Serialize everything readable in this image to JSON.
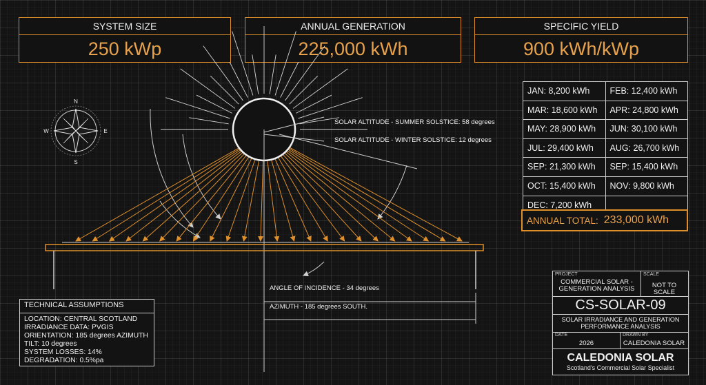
{
  "kpis": [
    {
      "label": "SYSTEM SIZE",
      "value": "250 kWp"
    },
    {
      "label": "ANNUAL GENERATION",
      "value": "225,000 kWh"
    },
    {
      "label": "SPECIFIC YIELD",
      "value": "900 kWh/kWp"
    }
  ],
  "diagram": {
    "summer_label": "SOLAR ALTITUDE - SUMMER SOLSTICE: 58 degrees",
    "winter_label": "SOLAR ALTITUDE - WINTER SOLSTICE: 12 degrees",
    "incidence_label": "ANGLE OF INCIDENCE - 34 degrees",
    "azimuth_label": "AZIMUTH - 185 degrees SOUTH.",
    "compass": {
      "n": "N",
      "e": "E",
      "s": "S",
      "w": "W"
    }
  },
  "monthly": {
    "rows": [
      [
        "JAN:  8,200 kWh",
        "FEB:  12,400 kWh"
      ],
      [
        "MAR: 18,600 kWh",
        "APR: 24,800 kWh"
      ],
      [
        "MAY: 28,900 kWh",
        "JUN: 30,100 kWh"
      ],
      [
        "JUL:  29,400 kWh",
        "AUG: 26,700 kWh"
      ],
      [
        "SEP: 21,300 kWh",
        "SEP: 15,400 kWh"
      ],
      [
        "OCT: 15,400 kWh",
        "NOV:  9,800 kWh"
      ],
      [
        "DEC:  7,200 kWh",
        ""
      ]
    ],
    "annual_label": "ANNUAL TOTAL:",
    "annual_value": "233,000 kWh"
  },
  "technical": {
    "title": "TECHNICAL ASSUMPTIONS",
    "lines": [
      "LOCATION: CENTRAL SCOTLAND",
      "IRRADIANCE DATA: PVGIS",
      "ORIENTATION: 185 degrees AZIMUTH",
      "TILT: 10 degrees",
      "SYSTEM LOSSES: 14%",
      "DEGRADATION: 0.5%pa"
    ]
  },
  "title_block": {
    "project_caption": "PROJECT",
    "project_line1": "COMMERCIAL SOLAR -",
    "project_line2": "GENERATION ANALYSIS",
    "scale_caption": "SCALE",
    "scale_value": "NOT TO SCALE",
    "drawing_number": "CS-SOLAR-09",
    "subtitle_line1": "SOLAR IRRADIANCE AND GENERATION",
    "subtitle_line2": "PERFORMANCE ANALYSIS",
    "date_caption": "DATE",
    "date_value": "2026",
    "drawn_caption": "DRAWN BY",
    "drawn_value": "CALEDONIA SOLAR",
    "company": "CALEDONIA SOLAR",
    "tagline": "Scotland's Commercial Solar Specialist"
  },
  "colors": {
    "accent": "#e0902a",
    "accent_text": "#e8a24c",
    "line": "#cfcfcf",
    "background": "#141414"
  }
}
